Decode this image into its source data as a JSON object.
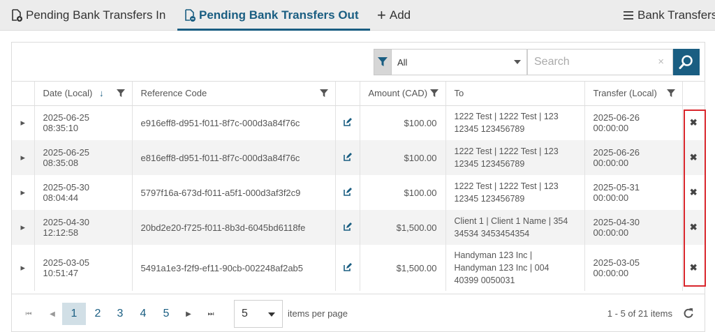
{
  "tabs": {
    "in_label": "Pending Bank Transfers In",
    "out_label": "Pending Bank Transfers Out",
    "add_label": "Add",
    "bank_transfers_label": "Bank Transfers"
  },
  "toolbar": {
    "filter_value": "All",
    "search_placeholder": "Search",
    "clear_glyph": "×"
  },
  "columns": {
    "date": "Date (Local)",
    "date_sort_glyph": "↓",
    "reference": "Reference Code",
    "amount": "Amount (CAD)",
    "to": "To",
    "transfer": "Transfer (Local)"
  },
  "rows": [
    {
      "date": "2025-06-25 08:35:10",
      "reference": "e916eff8-d951-f011-8f7c-000d3a84f76c",
      "amount": "$100.00",
      "to": "1222 Test | 1222 Test | 123 12345 123456789",
      "transfer": "2025-06-26 00:00:00"
    },
    {
      "date": "2025-06-25 08:35:08",
      "reference": "e816eff8-d951-f011-8f7c-000d3a84f76c",
      "amount": "$100.00",
      "to": "1222 Test | 1222 Test | 123 12345 123456789",
      "transfer": "2025-06-26 00:00:00"
    },
    {
      "date": "2025-05-30 08:04:44",
      "reference": "5797f16a-673d-f011-a5f1-000d3af3f2c9",
      "amount": "$100.00",
      "to": "1222 Test | 1222 Test | 123 12345 123456789",
      "transfer": "2025-05-31 00:00:00"
    },
    {
      "date": "2025-04-30 12:12:58",
      "reference": "20bd2e20-f725-f011-8b3d-6045bd6118fe",
      "amount": "$1,500.00",
      "to": "Client 1 | Client 1 Name | 354 34534 3453454354",
      "transfer": "2025-04-30 00:00:00"
    },
    {
      "date": "2025-03-05 10:51:47",
      "reference": "5491a1e3-f2f9-ef11-90cb-002248af2ab5",
      "amount": "$1,500.00",
      "to": "Handyman 123 Inc | Handyman 123 Inc | 004 40399 0050031",
      "transfer": "2025-03-05 00:00:00"
    }
  ],
  "row_glyphs": {
    "expand": "▸",
    "delete": "✖"
  },
  "pager": {
    "first": "⏮",
    "prev": "◀",
    "pages": [
      "1",
      "2",
      "3",
      "4",
      "5"
    ],
    "next": "▶",
    "last": "⏭",
    "page_size": "5",
    "items_per_page": "items per page",
    "range": "1 - 5 of 21 items"
  },
  "colors": {
    "accent": "#1a5e82",
    "highlight": "#d9262c"
  }
}
